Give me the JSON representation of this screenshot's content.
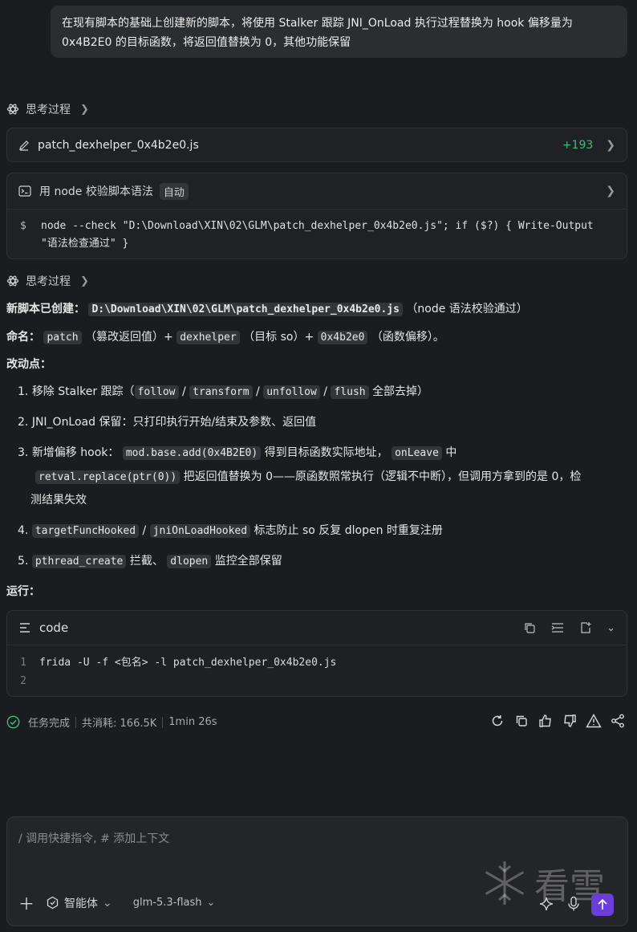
{
  "user_message": "在现有脚本的基础上创建新的脚本，将使用 Stalker 跟踪 JNI_OnLoad 执行过程替换为 hook 偏移量为 0x4B2E0 的目标函数，将返回值替换为 0，其他功能保留",
  "thinking_label_1": "思考过程",
  "file_change": {
    "filename": "patch_dexhelper_0x4b2e0.js",
    "additions": "+193"
  },
  "command_card": {
    "title": "用 node 校验脚本语法",
    "badge": "自动",
    "prompt": "$",
    "command": "node --check \"D:\\Download\\XIN\\02\\GLM\\patch_dexhelper_0x4b2e0.js\"; if ($?) { Write-Output \"语法检查通过\" }"
  },
  "thinking_label_2": "思考过程",
  "answer": {
    "created_label": "新脚本已创建：",
    "created_path": "D:\\Download\\XIN\\02\\GLM\\patch_dexhelper_0x4b2e0.js",
    "created_note": "（node 语法校验通过）",
    "naming_label": "命名：",
    "naming_patch": "patch",
    "naming_patch_note": "（篡改返回值）+",
    "naming_dexhelper": "dexhelper",
    "naming_dexhelper_note": "（目标 so）+",
    "naming_offset": "0x4b2e0",
    "naming_offset_note": "（函数偏移）。",
    "changes_heading": "改动点：",
    "item1_num": "1.",
    "item1_text": "移除 Stalker 跟踪（",
    "item1_c1": "follow",
    "item1_c2": "transform",
    "item1_c3": "unfollow",
    "item1_c4": "flush",
    "item1_end": "全部去掉）",
    "slash": "/",
    "item2_num": "2.",
    "item2_text": "JNI_OnLoad 保留：只打印执行开始/结束及参数、返回值",
    "item3_num": "3.",
    "item3_a": "新增偏移 hook：",
    "item3_c1": "mod.base.add(0x4B2E0)",
    "item3_b": "得到目标函数实际地址，",
    "item3_c2": "onLeave",
    "item3_c": "中",
    "item3_c3": "retval.replace(ptr(0))",
    "item3_d": "把返回值替换为 0——原函数照常执行（逻辑不中断），但调用方拿到的是 0，检",
    "item3_e": "测结果失效",
    "item4_num": "4.",
    "item4_c1": "targetFuncHooked",
    "item4_c2": "jniOnLoadHooked",
    "item4_text": "标志防止 so 反复 dlopen 时重复注册",
    "item5_num": "5.",
    "item5_c1": "pthread_create",
    "item5_a": "拦截、",
    "item5_c2": "dlopen",
    "item5_b": "监控全部保留",
    "run_heading": "运行："
  },
  "code_block": {
    "language": "code",
    "lines": [
      {
        "num": "1",
        "text": "frida -U -f <包名> -l patch_dexhelper_0x4b2e0.js"
      },
      {
        "num": "2",
        "text": ""
      }
    ]
  },
  "status": {
    "task": "任务完成",
    "tokens": "共消耗: 166.5K",
    "time": "1min 26s"
  },
  "input": {
    "placeholder": "/ 调用快捷指令, # 添加上下文",
    "agent_label": "智能体",
    "model_label": "glm-5.3-flash"
  },
  "watermark": "看雪",
  "colors": {
    "accent_green": "#3dbb7a",
    "send_purple": "#6a3fd9"
  }
}
